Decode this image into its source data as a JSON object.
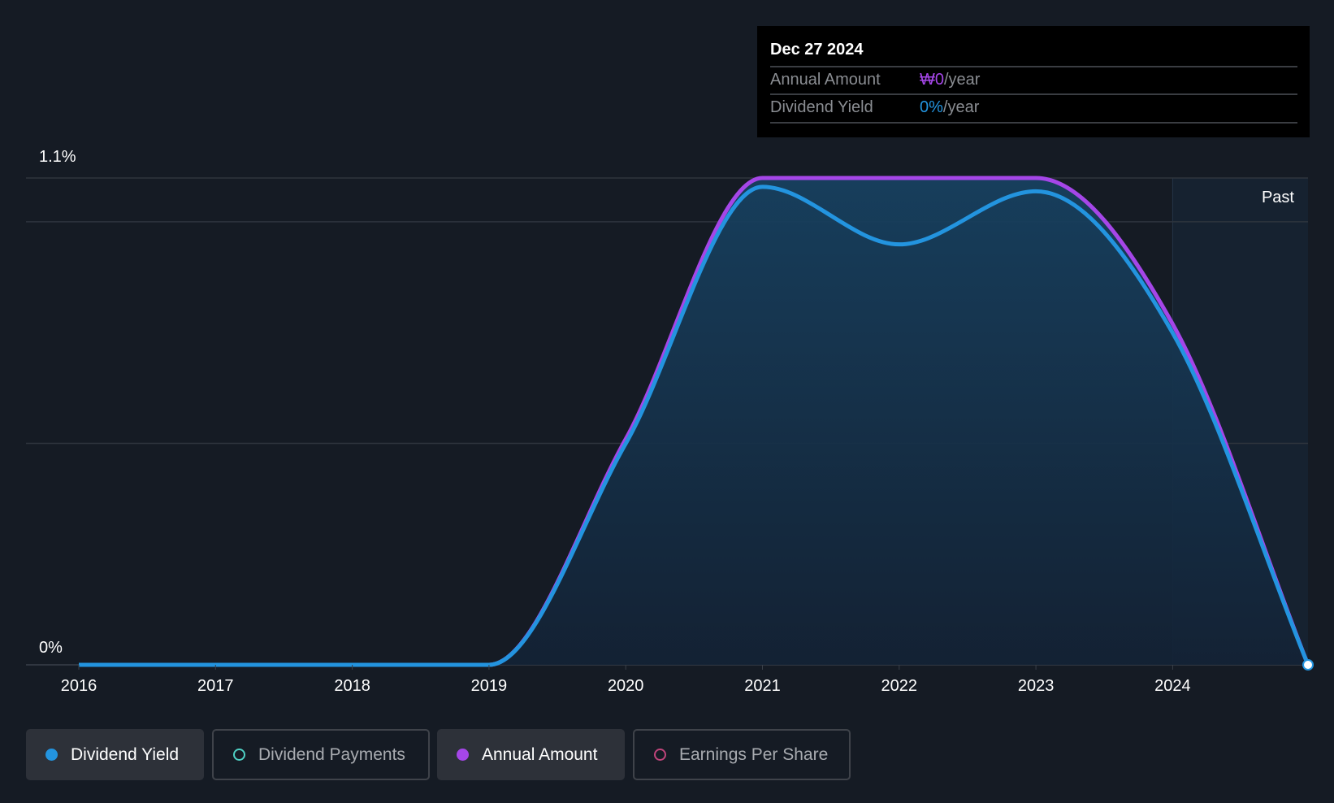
{
  "chart_data": {
    "type": "area",
    "title": "",
    "xlabel": "",
    "ylabel": "",
    "y_tick_labels": [
      "0%",
      "1.1%"
    ],
    "ylim": [
      0,
      1.1
    ],
    "x_tick_labels": [
      "2016",
      "2017",
      "2018",
      "2019",
      "2020",
      "2021",
      "2022",
      "2023",
      "2024"
    ],
    "xlim": [
      2015.6,
      2024.99
    ],
    "region_label": "Past",
    "region_start": 2024.0,
    "grid": true,
    "series": [
      {
        "name": "Dividend Yield",
        "color": "#2394df",
        "unit": "%",
        "x": [
          2016,
          2019.0,
          2020,
          2021,
          2022,
          2023,
          2024,
          2024.99
        ],
        "values": [
          0,
          0,
          0.5,
          1.08,
          0.95,
          1.07,
          0.75,
          0
        ]
      },
      {
        "name": "Annual Amount",
        "color": "#a546e8",
        "unit": "relative (scaled to yield axis)",
        "x": [
          2016,
          2019.0,
          2020,
          2021,
          2022,
          2023,
          2024,
          2024.99
        ],
        "values": [
          0,
          0,
          0.51,
          1.1,
          1.1,
          1.1,
          0.77,
          0
        ]
      }
    ]
  },
  "tooltip": {
    "date": "Dec 27 2024",
    "rows": [
      {
        "label": "Annual Amount",
        "value": "₩0",
        "suffix": "/year",
        "color": "#a546e8"
      },
      {
        "label": "Dividend Yield",
        "value": "0%",
        "suffix": "/year",
        "color": "#2394df"
      }
    ]
  },
  "legend": [
    {
      "label": "Dividend Yield",
      "color": "#2394df",
      "active": true
    },
    {
      "label": "Dividend Payments",
      "color": "#4fd1c5",
      "active": false
    },
    {
      "label": "Annual Amount",
      "color": "#a546e8",
      "active": true
    },
    {
      "label": "Earnings Per Share",
      "color": "#c0457b",
      "active": false
    }
  ]
}
